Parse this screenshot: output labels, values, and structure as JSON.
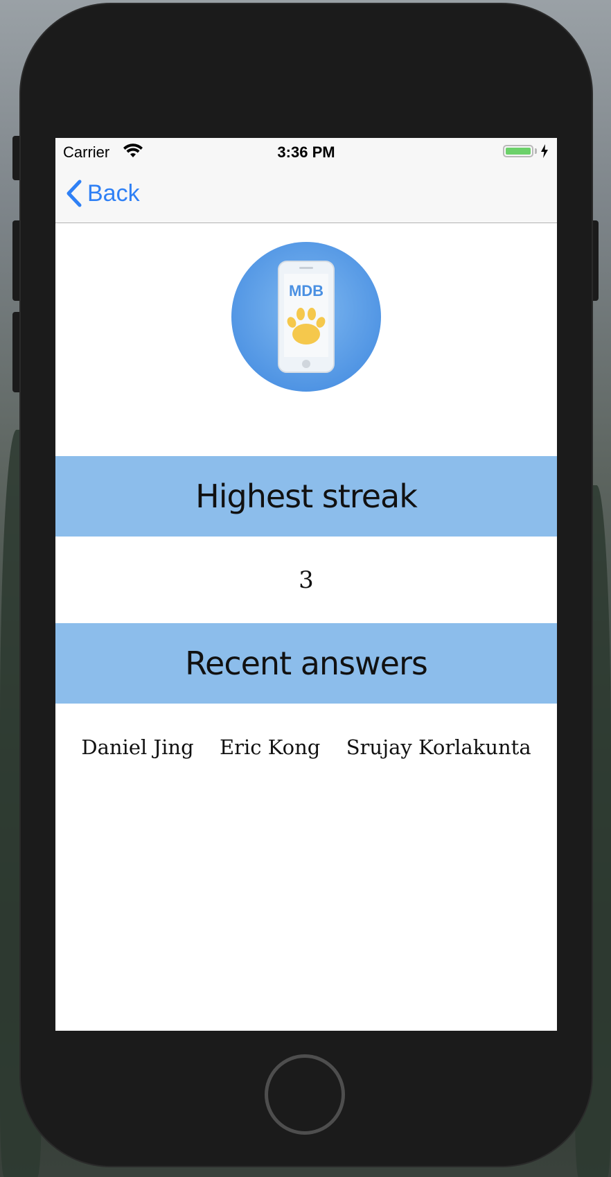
{
  "status_bar": {
    "carrier": "Carrier",
    "time": "3:36 PM",
    "wifi_icon": "wifi-icon",
    "battery_icon": "battery-charging-icon"
  },
  "nav": {
    "back_label": "Back",
    "back_icon": "chevron-left-icon"
  },
  "logo": {
    "text": "MDB",
    "icon": "phone-paw-logo"
  },
  "sections": {
    "highest_streak_title": "Highest streak",
    "highest_streak_value": "3",
    "recent_answers_title": "Recent answers"
  },
  "recent_answers": [
    "Daniel Jing",
    "Eric Kong",
    "Srujay Korlakunta"
  ],
  "colors": {
    "accent": "#2f80f5",
    "section_header": "#8cbdeb",
    "logo_circle": "#4a90e2",
    "paw": "#f5c84c"
  }
}
